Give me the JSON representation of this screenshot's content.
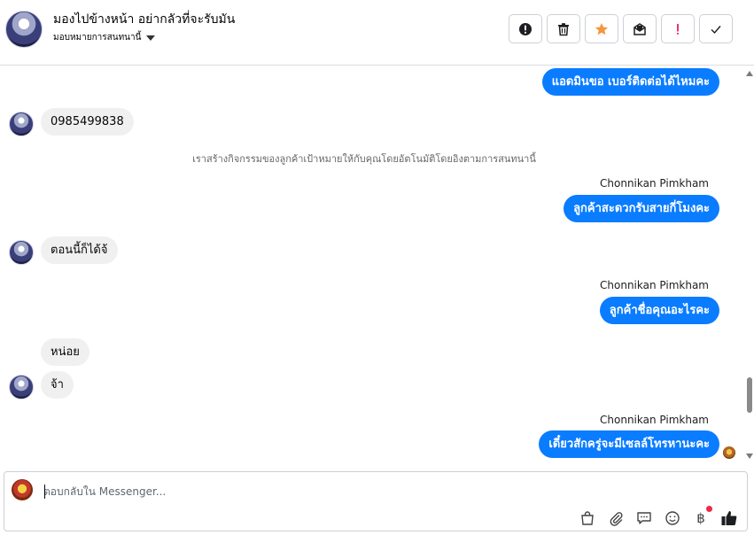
{
  "header": {
    "contact_name": "มองไปข้างหน้า อย่ากลัวที่จะรับมัน",
    "assign_label": "มอบหมายการสนทนานี้",
    "actions": [
      {
        "name": "mark-spam-button",
        "icon": "alert-circle-icon"
      },
      {
        "name": "delete-button",
        "icon": "trash-icon"
      },
      {
        "name": "star-button",
        "icon": "star-icon"
      },
      {
        "name": "mark-unread-button",
        "icon": "envelope-icon"
      },
      {
        "name": "flag-button",
        "icon": "exclamation-icon"
      },
      {
        "name": "done-button",
        "icon": "check-icon"
      }
    ],
    "star_color": "#f5963a",
    "flag_color": "#e0245e"
  },
  "messages": {
    "m1": "แอดมินขอ เบอร์ติดต่อได้ไหมคะ",
    "m2": "0985499838",
    "system": "เราสร้างกิจกรรมของลูกค้าเป้าหมายให้กับคุณโดยอัตโนมัติโดยอิงตามการสนทนานี้",
    "sender1": "Chonnikan Pimkham",
    "m3": "ลูกค้าสะดวกรับสายกี่โมงคะ",
    "m4": "ตอนนี้ก็ได้จ้",
    "sender2": "Chonnikan Pimkham",
    "m5": "ลูกค้าชื่อคุณอะไรคะ",
    "m6": "หน่อย",
    "m7": "จ้า",
    "sender3": "Chonnikan Pimkham",
    "m8": "เดี๋ยวสักครู่จะมีเซลล์โทรหานะคะ"
  },
  "colors": {
    "outgoing_bubble": "#0a7cff",
    "incoming_bubble": "#f0f0f0"
  },
  "composer": {
    "placeholder": "ตอบกลับใน Messenger...",
    "tools": [
      "shopping-bag-icon",
      "paperclip-icon",
      "saved-reply-icon",
      "emoji-icon",
      "baht-payment-icon",
      "like-icon"
    ],
    "baht_symbol": "฿"
  }
}
